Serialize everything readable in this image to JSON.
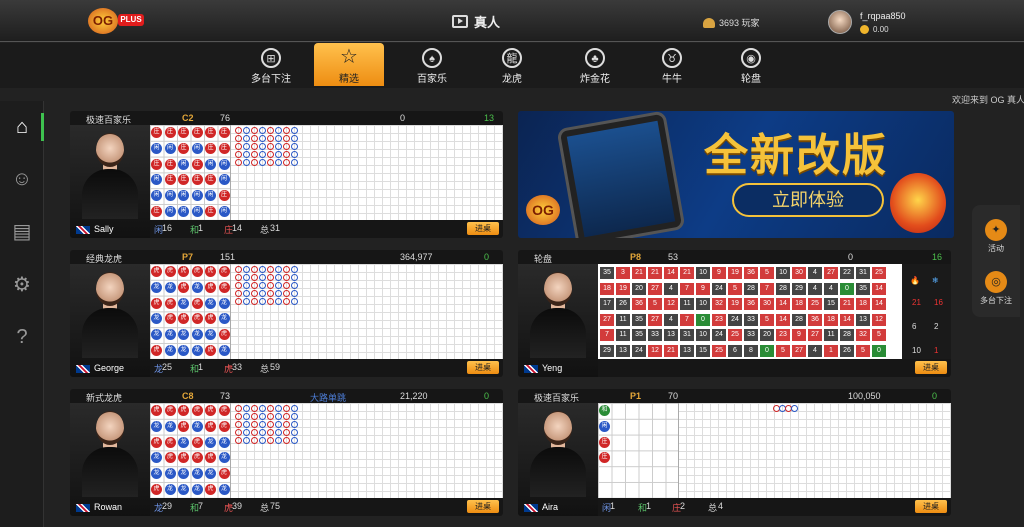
{
  "top": {
    "logo_main": "OG",
    "logo_badge": "PLUS",
    "title": "真人",
    "players": "3693 玩家",
    "username": "f_rqpaa850",
    "balance": "0.00"
  },
  "categories": [
    {
      "label": "多台下注",
      "icon": "multi-table-icon"
    },
    {
      "label": "精选",
      "icon": "star-icon",
      "active": true
    },
    {
      "label": "百家乐",
      "icon": "cards-icon"
    },
    {
      "label": "龙虎",
      "icon": "dragon-icon"
    },
    {
      "label": "炸金花",
      "icon": "spades-icon"
    },
    {
      "label": "牛牛",
      "icon": "bull-icon"
    },
    {
      "label": "轮盘",
      "icon": "roulette-icon"
    }
  ],
  "marquee": "欢迎来到 OG 真人",
  "sidebar": [
    "home-icon",
    "users-icon",
    "clipboard-icon",
    "settings-icon",
    "help-icon"
  ],
  "banner": {
    "headline": "全新改版",
    "cta": "立即体验",
    "logo": "OG"
  },
  "right_panel": {
    "activity": "活动",
    "multi": "多台下注"
  },
  "join_label": "进桌",
  "tables": [
    {
      "game": "极速百家乐",
      "code": "C2",
      "players": "76",
      "middle": "",
      "pool": "0",
      "right": "13",
      "dealer": "Sally",
      "stats": {
        "a_label": "闲",
        "a": "16",
        "b_label": "和",
        "b": "1",
        "c_label": "庄",
        "c": "14",
        "t_label": "总",
        "t": "31"
      }
    },
    {
      "game": "经典龙虎",
      "code": "P7",
      "players": "151",
      "middle": "",
      "pool": "364,977",
      "right": "0",
      "dealer": "George",
      "stats": {
        "a_label": "龙",
        "a": "25",
        "b_label": "和",
        "b": "1",
        "c_label": "虎",
        "c": "33",
        "t_label": "总",
        "t": "59"
      }
    },
    {
      "game": "轮盘",
      "code": "P8",
      "players": "53",
      "middle": "",
      "pool": "0",
      "right": "16",
      "dealer": "Yeng",
      "stats": {
        "a_label": "",
        "a": "",
        "b_label": "",
        "b": "",
        "c_label": "",
        "c": "",
        "t_label": "",
        "t": ""
      }
    },
    {
      "game": "新式龙虎",
      "code": "C8",
      "players": "73",
      "middle": "大路单跳",
      "pool": "21,220",
      "right": "0",
      "dealer": "Rowan",
      "stats": {
        "a_label": "龙",
        "a": "29",
        "b_label": "和",
        "b": "7",
        "c_label": "虎",
        "c": "39",
        "t_label": "总",
        "t": "75"
      }
    },
    {
      "game": "极速百家乐",
      "code": "P1",
      "players": "70",
      "middle": "",
      "pool": "100,050",
      "right": "0",
      "dealer": "Aira",
      "stats": {
        "a_label": "闲",
        "a": "1",
        "b_label": "和",
        "b": "1",
        "c_label": "庄",
        "c": "2",
        "t_label": "总",
        "t": "4"
      }
    }
  ],
  "roulette": {
    "rows": [
      [
        35,
        3,
        21,
        21,
        14,
        21,
        10,
        9,
        19,
        36,
        5,
        10,
        30,
        4,
        27,
        22,
        31,
        25
      ],
      [
        18,
        19,
        20,
        27,
        4,
        7,
        9,
        24,
        5,
        28,
        7,
        28,
        29,
        4,
        4,
        0,
        35,
        14
      ],
      [
        17,
        26,
        36,
        5,
        12,
        11,
        10,
        32,
        19,
        36,
        30,
        14,
        18,
        25,
        15,
        21,
        18,
        14
      ],
      [
        27,
        11,
        35,
        27,
        4,
        7,
        0,
        23,
        24,
        33,
        5,
        14,
        28,
        36,
        18,
        14,
        13,
        12
      ],
      [
        7,
        11,
        35,
        33,
        13,
        31,
        10,
        24,
        25,
        33,
        20,
        23,
        9,
        27,
        11,
        28,
        32,
        5
      ],
      [
        29,
        13,
        24,
        12,
        21,
        13,
        15,
        25,
        6,
        8,
        0,
        5,
        27,
        4,
        1,
        26,
        5,
        0
      ]
    ],
    "reds": [
      1,
      3,
      5,
      7,
      9,
      12,
      14,
      16,
      18,
      19,
      21,
      23,
      25,
      27,
      30,
      32,
      34,
      36
    ],
    "side_stats": [
      [
        "21",
        "16"
      ],
      [
        "6",
        "2"
      ],
      [
        "10",
        "1"
      ]
    ]
  },
  "colors": {
    "accent": "#f5a623",
    "banker": "#d02626",
    "player": "#2a58c6",
    "tie": "#2a8c36"
  }
}
